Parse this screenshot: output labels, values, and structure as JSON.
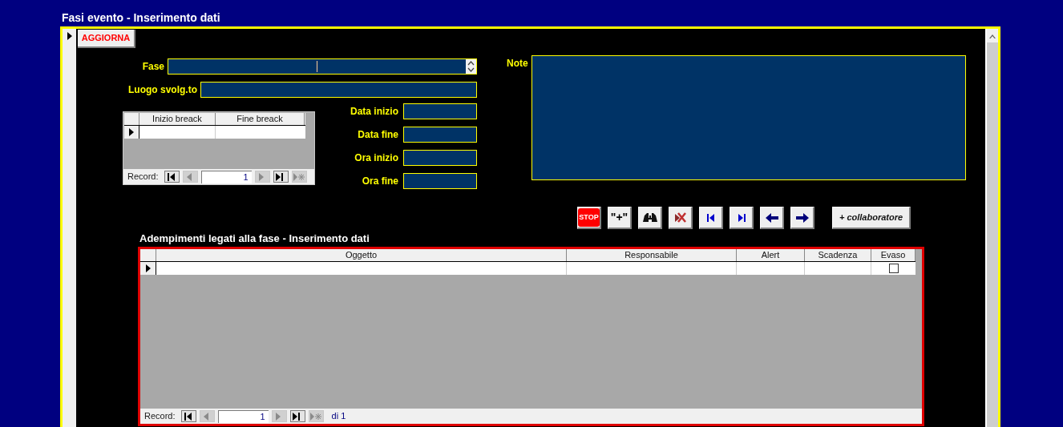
{
  "window": {
    "title": "Fasi evento - Inserimento dati"
  },
  "refresh_button": {
    "label": "AGGIORNA"
  },
  "fields": [
    {
      "label": "Fase",
      "kind": "combo"
    },
    {
      "label": "Luogo svolg.to",
      "kind": "text"
    }
  ],
  "breaks_subform": {
    "columns": [
      "Inizio breack",
      "Fine breack"
    ],
    "navigator": {
      "label": "Record:",
      "current": "1"
    }
  },
  "date_fields": [
    {
      "label": "Data inizio"
    },
    {
      "label": "Data fine"
    },
    {
      "label": "Ora inizio"
    },
    {
      "label": "Ora fine"
    }
  ],
  "note": {
    "label": "Note"
  },
  "toolbar": [
    {
      "kind": "stop",
      "label": "STOP"
    },
    {
      "kind": "text",
      "label": "\"+\""
    },
    {
      "kind": "binoculars"
    },
    {
      "kind": "delete"
    },
    {
      "kind": "first"
    },
    {
      "kind": "last"
    },
    {
      "kind": "prev"
    },
    {
      "kind": "next"
    },
    {
      "kind": "wide",
      "label": "+ collaboratore"
    }
  ],
  "tasks_subform": {
    "title": "Adempimenti legati alla fase - Inserimento dati",
    "columns": [
      "Oggetto",
      "Responsabile",
      "Alert",
      "Scadenza",
      "Evaso"
    ],
    "rows": [
      {
        "evaso": false
      }
    ],
    "navigator": {
      "label": "Record:",
      "current": "1",
      "total": "di 1"
    }
  }
}
